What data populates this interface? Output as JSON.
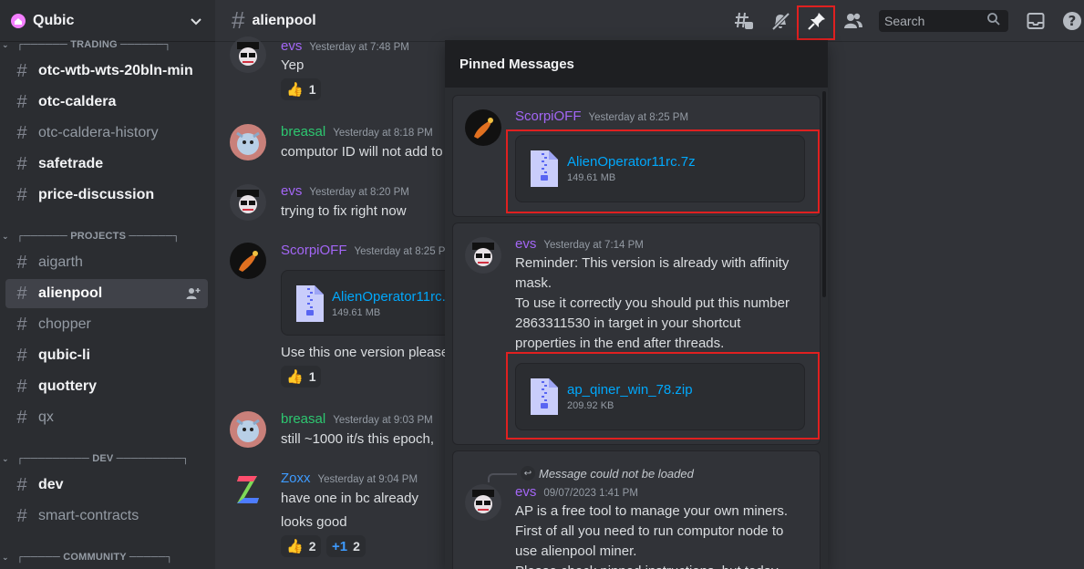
{
  "server": {
    "name": "Qubic"
  },
  "categories": {
    "trading": "TRADING",
    "projects": "PROJECTS",
    "dev": "DEV",
    "community": "COMMUNITY"
  },
  "channels": [
    {
      "name": "otc-wtb-wts-20bln-min",
      "state": "bright"
    },
    {
      "name": "otc-caldera",
      "state": "bright"
    },
    {
      "name": "otc-caldera-history",
      "state": "muted"
    },
    {
      "name": "safetrade",
      "state": "bright"
    },
    {
      "name": "price-discussion",
      "state": "bright"
    },
    {
      "name": "aigarth",
      "state": "muted"
    },
    {
      "name": "alienpool",
      "state": "active"
    },
    {
      "name": "chopper",
      "state": "muted"
    },
    {
      "name": "qubic-li",
      "state": "bright"
    },
    {
      "name": "quottery",
      "state": "bright"
    },
    {
      "name": "qx",
      "state": "muted"
    },
    {
      "name": "dev",
      "state": "bright"
    },
    {
      "name": "smart-contracts",
      "state": "muted"
    }
  ],
  "topbar": {
    "channel": "alienpool",
    "search_placeholder": "Search",
    "icons": [
      "threads-icon",
      "mute-icon",
      "pin-icon",
      "members-icon",
      "inbox-icon",
      "help-icon"
    ]
  },
  "messages": [
    {
      "author": "evs",
      "color": "#a366f5",
      "time": "Yesterday at 7:48 PM",
      "text": "Yep",
      "reaction": {
        "emoji": "👍",
        "count": "1"
      }
    },
    {
      "author": "breasal",
      "color": "#2dc770",
      "time": "Yesterday at 8:18 PM",
      "text": "computor ID will not add to"
    },
    {
      "author": "evs",
      "color": "#a366f5",
      "time": "Yesterday at 8:20 PM",
      "text": "trying to fix right now"
    },
    {
      "author": "ScorpiOFF",
      "color": "#a366f5",
      "time": "Yesterday at 8:25 PM",
      "file": {
        "name": "AlienOperator11rc.7z",
        "size": "149.61 MB"
      },
      "text": "Use this one version please",
      "reaction": {
        "emoji": "👍",
        "count": "1"
      }
    },
    {
      "author": "breasal",
      "color": "#2dc770",
      "time": "Yesterday at 9:03 PM",
      "text": "still ~1000 it/s this epoch,"
    },
    {
      "author": "Zoxx",
      "color": "#3e9bff",
      "time": "Yesterday at 9:04 PM",
      "text": "have one in bc already",
      "text2": "looks good",
      "reactions": [
        {
          "emoji": "👍",
          "count": "2"
        },
        {
          "emoji": "+1",
          "count": "2"
        }
      ]
    }
  ],
  "pinned": {
    "title": "Pinned Messages",
    "items": [
      {
        "author": "ScorpiOFF",
        "color": "#a366f5",
        "time": "Yesterday at 8:25 PM",
        "file": {
          "name": "AlienOperator11rc.7z",
          "size": "149.61 MB"
        }
      },
      {
        "author": "evs",
        "color": "#a366f5",
        "time": "Yesterday at 7:14 PM",
        "lines": [
          "Reminder: This version is already with affinity",
          "mask.",
          "To use it correctly you should put this number",
          "2863311530 in target in your shortcut",
          "properties in the end after threads."
        ],
        "file": {
          "name": "ap_qiner_win_78.zip",
          "size": "209.92 KB"
        }
      },
      {
        "reply": "Message could not be loaded",
        "author": "evs",
        "color": "#a366f5",
        "time": "09/07/2023 1:41 PM",
        "lines": [
          "AP is a free tool to manage your own miners.",
          "First of all you need to run computor node to",
          "use alienpool miner.",
          "Please check pinned instructions, but today"
        ]
      }
    ]
  }
}
